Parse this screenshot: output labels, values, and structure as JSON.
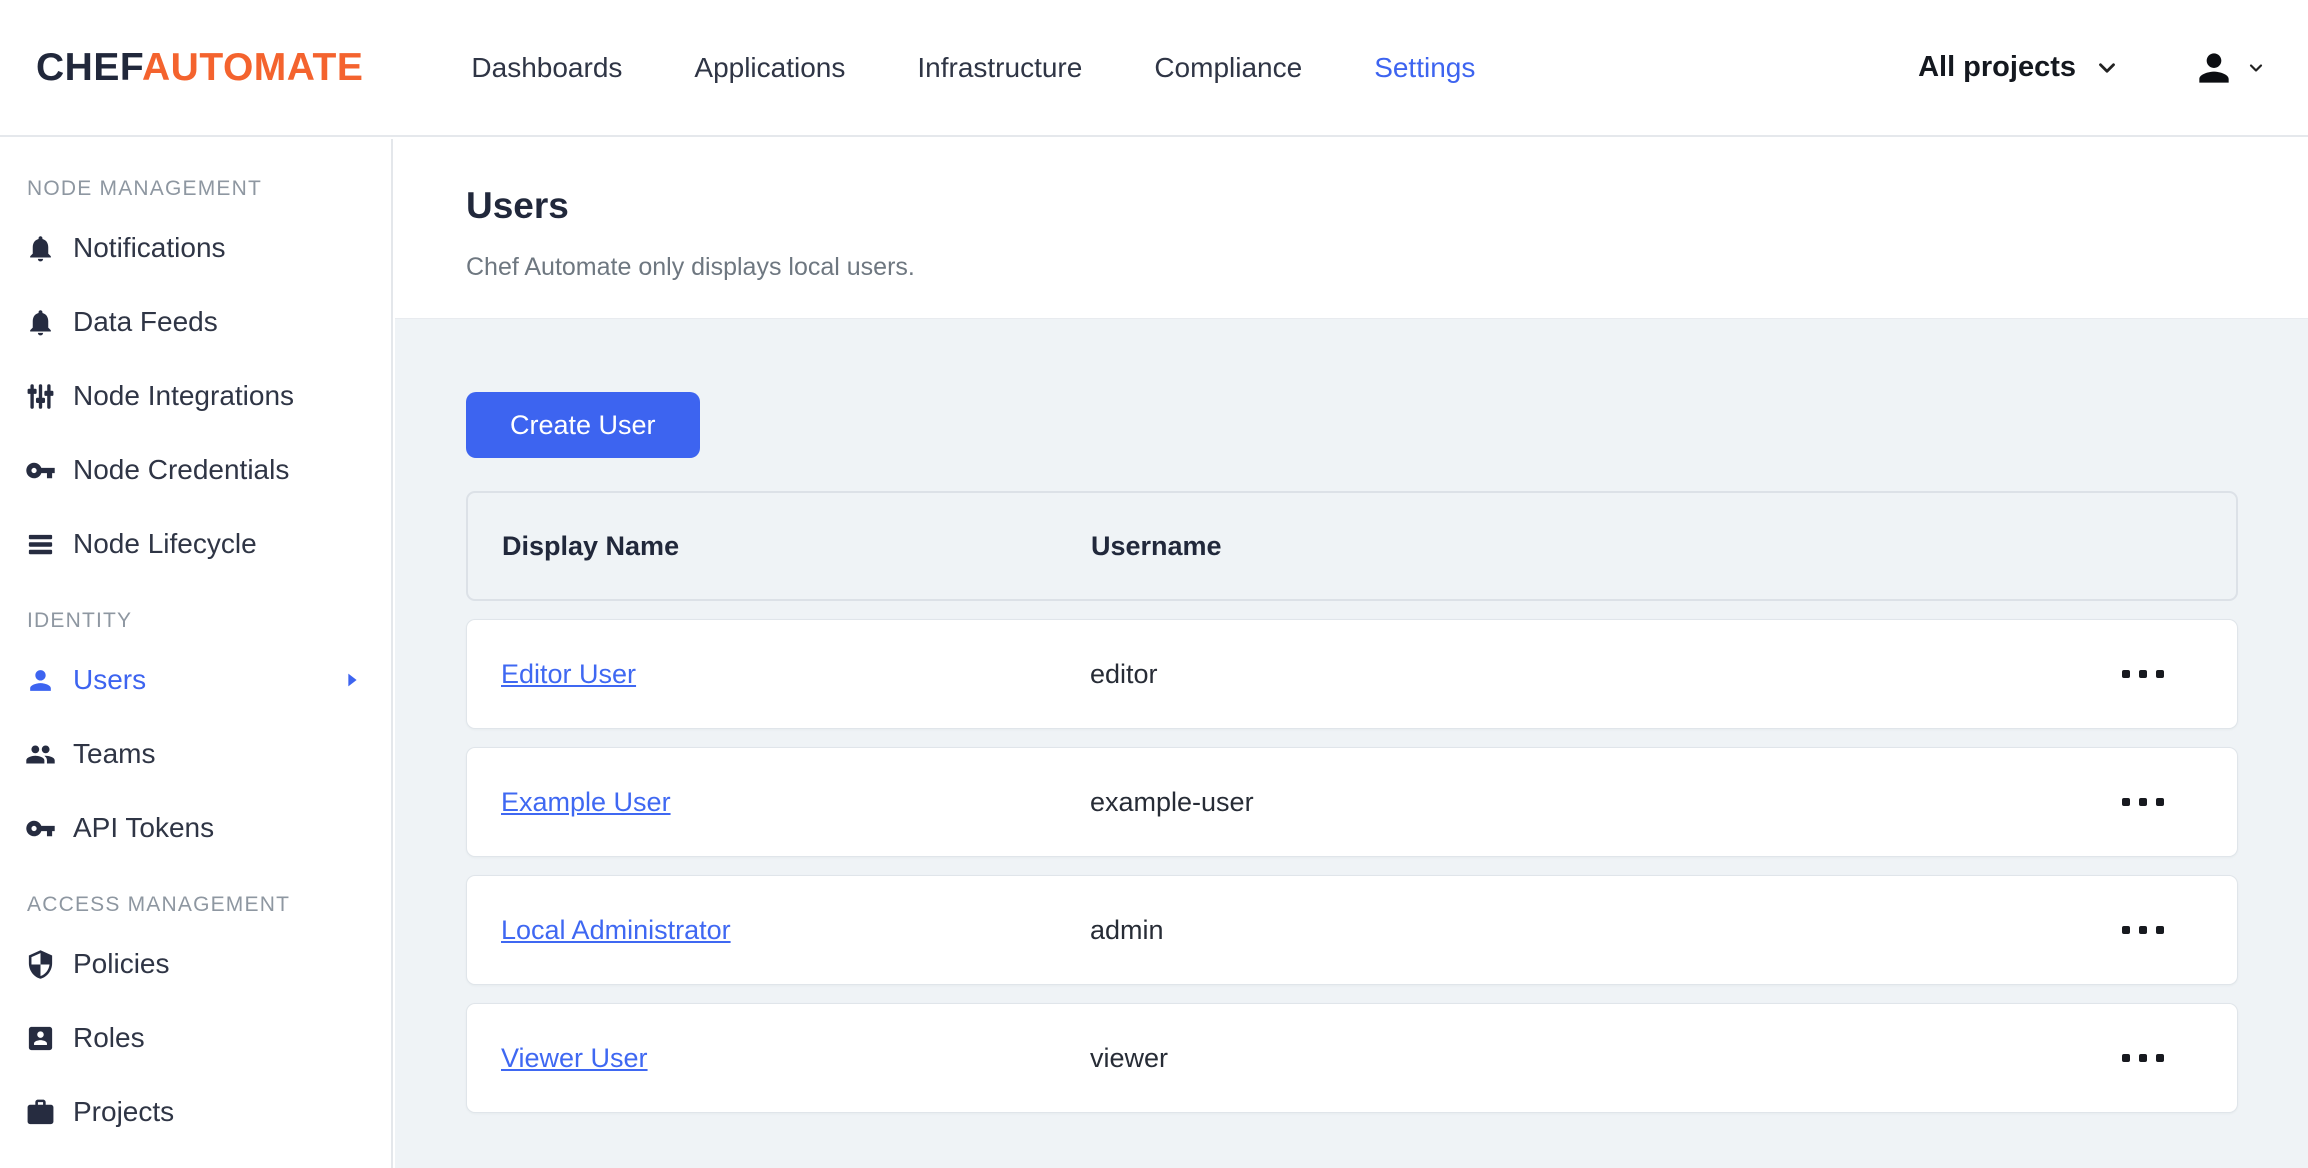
{
  "brand": {
    "chef": "CHEF",
    "automate": "AUTOMATE"
  },
  "nav": {
    "items": [
      {
        "label": "Dashboards",
        "active": false
      },
      {
        "label": "Applications",
        "active": false
      },
      {
        "label": "Infrastructure",
        "active": false
      },
      {
        "label": "Compliance",
        "active": false
      },
      {
        "label": "Settings",
        "active": true
      }
    ],
    "project_filter": "All projects"
  },
  "sidebar": {
    "sections": [
      {
        "label": "NODE MANAGEMENT",
        "items": [
          {
            "label": "Notifications",
            "icon": "bell"
          },
          {
            "label": "Data Feeds",
            "icon": "bell"
          },
          {
            "label": "Node Integrations",
            "icon": "sliders"
          },
          {
            "label": "Node Credentials",
            "icon": "key"
          },
          {
            "label": "Node Lifecycle",
            "icon": "list"
          }
        ]
      },
      {
        "label": "IDENTITY",
        "items": [
          {
            "label": "Users",
            "icon": "person",
            "active": true
          },
          {
            "label": "Teams",
            "icon": "people"
          },
          {
            "label": "API Tokens",
            "icon": "key"
          }
        ]
      },
      {
        "label": "ACCESS MANAGEMENT",
        "items": [
          {
            "label": "Policies",
            "icon": "shield"
          },
          {
            "label": "Roles",
            "icon": "badge"
          },
          {
            "label": "Projects",
            "icon": "briefcase"
          }
        ]
      }
    ]
  },
  "main": {
    "title": "Users",
    "subtitle": "Chef Automate only displays local users.",
    "create_button": "Create User",
    "table": {
      "columns": [
        "Display Name",
        "Username"
      ],
      "rows": [
        {
          "display_name": "Editor User",
          "username": "editor"
        },
        {
          "display_name": "Example User",
          "username": "example-user"
        },
        {
          "display_name": "Local Administrator",
          "username": "admin"
        },
        {
          "display_name": "Viewer User",
          "username": "viewer"
        }
      ]
    }
  },
  "colors": {
    "accent": "#3d64f0",
    "brand_orange": "#f4632e",
    "link": "#3f68f2",
    "text_dark": "#21283b",
    "bg_gray": "#eff3f6"
  }
}
